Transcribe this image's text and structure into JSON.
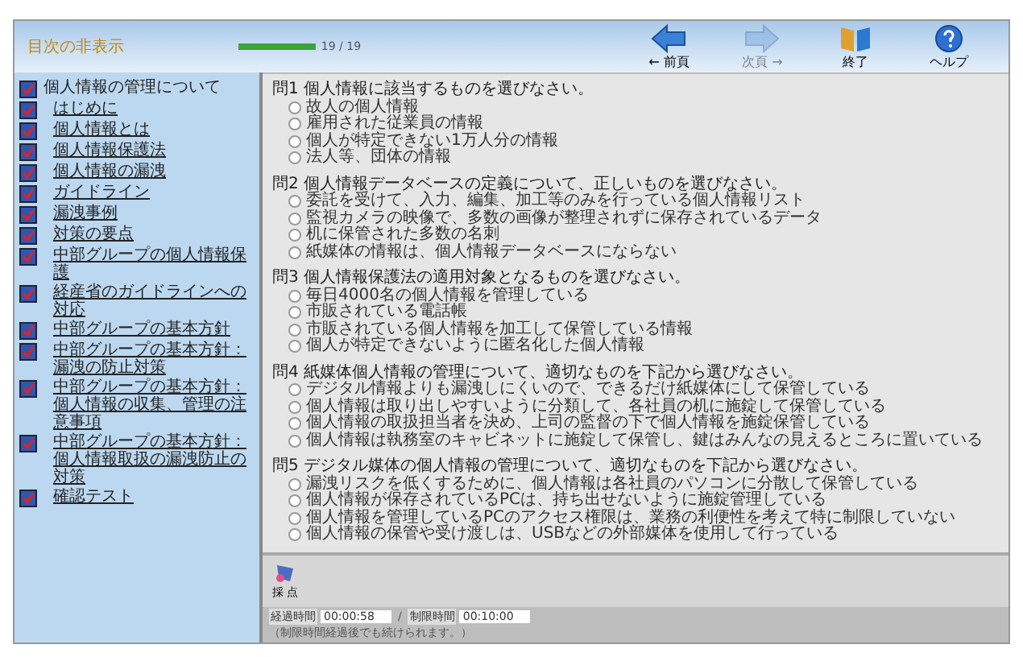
{
  "header": {
    "toggle_toc": "目次の非表示",
    "progress": {
      "level": 1,
      "reading": "19 / 19"
    },
    "buttons": [
      {
        "kind": "prev",
        "label": "← 前頁",
        "disabled": false
      },
      {
        "kind": "next",
        "label": "次頁 →",
        "disabled": true
      },
      {
        "kind": "exit",
        "label": "終了",
        "disabled": false
      },
      {
        "kind": "help",
        "label": "ヘルプ",
        "disabled": false
      }
    ]
  },
  "sidebar": {
    "items": [
      {
        "label": "個人情報の管理について",
        "checked": true,
        "link": false
      },
      {
        "label": "はじめに",
        "checked": true,
        "link": true
      },
      {
        "label": "個人情報とは",
        "checked": true,
        "link": true
      },
      {
        "label": "個人情報保護法",
        "checked": true,
        "link": true
      },
      {
        "label": "個人情報の漏洩",
        "checked": true,
        "link": true
      },
      {
        "label": "ガイドライン",
        "checked": true,
        "link": true
      },
      {
        "label": "漏洩事例",
        "checked": true,
        "link": true
      },
      {
        "label": "対策の要点",
        "checked": true,
        "link": true
      },
      {
        "label": "中部グループの個人情報保護",
        "checked": true,
        "link": true
      },
      {
        "label": "経産省のガイドラインへの対応",
        "checked": true,
        "link": true
      },
      {
        "label": "中部グループの基本方針",
        "checked": true,
        "link": true
      },
      {
        "label": "中部グループの基本方針：漏洩の防止対策",
        "checked": true,
        "link": true
      },
      {
        "label": "中部グループの基本方針：個人情報の収集、管理の注意事項",
        "checked": true,
        "link": true
      },
      {
        "label": "中部グループの基本方針：個人情報取扱の漏洩防止の対策",
        "checked": true,
        "link": true
      },
      {
        "label": "確認テスト",
        "checked": true,
        "link": true
      }
    ]
  },
  "questions": [
    {
      "prompt": "問1 個人情報に該当するものを選びなさい。",
      "options": [
        {
          "label": "故人の個人情報",
          "selected": false
        },
        {
          "label": "雇用された従業員の情報",
          "selected": false
        },
        {
          "label": "個人が特定できない1万人分の情報",
          "selected": false
        },
        {
          "label": "法人等、団体の情報",
          "selected": false
        }
      ]
    },
    {
      "prompt": "問2 個人情報データベースの定義について、正しいものを選びなさい。",
      "options": [
        {
          "label": "委託を受けて、入力、編集、加工等のみを行っている個人情報リスト",
          "selected": false
        },
        {
          "label": "監視カメラの映像で、多数の画像が整理されずに保存されているデータ",
          "selected": false
        },
        {
          "label": "机に保管された多数の名刺",
          "selected": false
        },
        {
          "label": "紙媒体の情報は、個人情報データベースにならない",
          "selected": false
        }
      ]
    },
    {
      "prompt": "問3 個人情報保護法の適用対象となるものを選びなさい。",
      "options": [
        {
          "label": "毎日4000名の個人情報を管理している",
          "selected": false
        },
        {
          "label": "市販されている電話帳",
          "selected": false
        },
        {
          "label": "市販されている個人情報を加工して保管している情報",
          "selected": false
        },
        {
          "label": "個人が特定できないように匿名化した個人情報",
          "selected": false
        }
      ]
    },
    {
      "prompt": "問4 紙媒体個人情報の管理について、適切なものを下記から選びなさい。",
      "options": [
        {
          "label": "デジタル情報よりも漏洩しにくいので、できるだけ紙媒体にして保管している",
          "selected": false
        },
        {
          "label": "個人情報は取り出しやすいように分類して、各社員の机に施錠して保管している",
          "selected": false
        },
        {
          "label": "個人情報の取扱担当者を決め、上司の監督の下で個人情報を施錠保管している",
          "selected": false
        },
        {
          "label": "個人情報は執務室のキャビネットに施錠して保管し、鍵はみんなの見えるところに置いている",
          "selected": false
        }
      ]
    },
    {
      "prompt": "問5 デジタル媒体の個人情報の管理について、適切なものを下記から選びなさい。",
      "options": [
        {
          "label": "漏洩リスクを低くするために、個人情報は各社員のパソコンに分散して保管している",
          "selected": false
        },
        {
          "label": "個人情報が保存されているPCは、持ち出せないように施錠管理している",
          "selected": false
        },
        {
          "label": "個人情報を管理しているPCのアクセス権限は、業務の利便性を考えて特に制限していない",
          "selected": false
        },
        {
          "label": "個人情報の保管や受け渡しは、USBなどの外部媒体を使用して行っている",
          "selected": false
        }
      ]
    }
  ],
  "footer": {
    "grade_button": "採 点",
    "elapsed": {
      "label": "経過時間",
      "value": "00:00:58"
    },
    "separator": "/",
    "limit": {
      "label": "制限時間",
      "value": "00:10:00"
    },
    "note": "（制限時間経過後でも続けられます。）"
  }
}
